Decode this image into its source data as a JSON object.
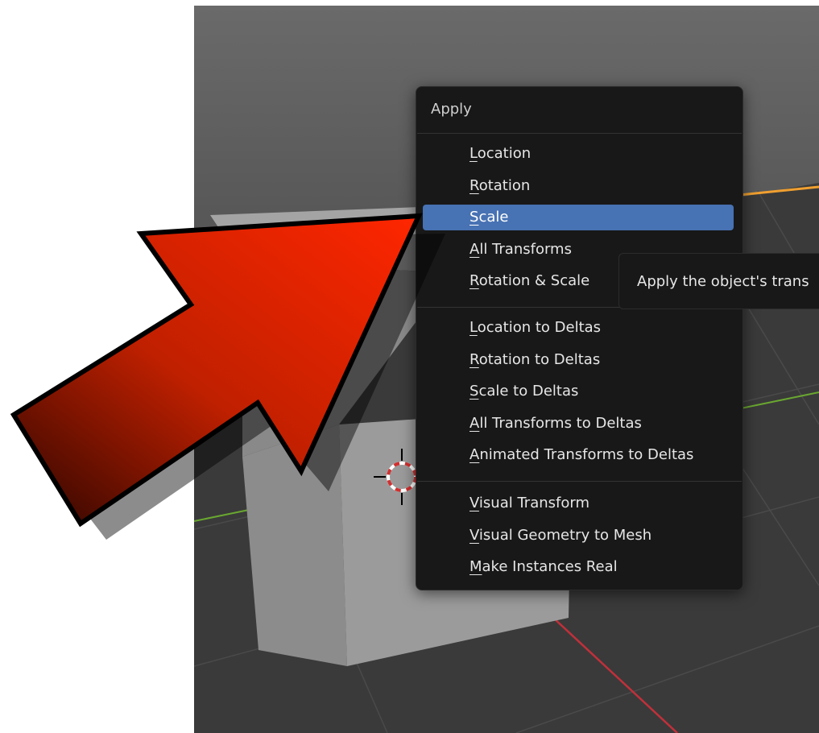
{
  "menu": {
    "title": "Apply",
    "groups": [
      [
        {
          "label": "Location",
          "ul": "L",
          "rest": "ocation",
          "active": false
        },
        {
          "label": "Rotation",
          "ul": "R",
          "rest": "otation",
          "active": false
        },
        {
          "label": "Scale",
          "ul": "S",
          "rest": "cale",
          "active": true
        },
        {
          "label": "All Transforms",
          "ul": "A",
          "rest": "ll Transforms",
          "active": false
        },
        {
          "label": "Rotation & Scale",
          "ul": "R",
          "rest": "otation & Scale",
          "active": false
        }
      ],
      [
        {
          "label": "Location to Deltas",
          "ul": "L",
          "rest": "ocation to Deltas",
          "active": false
        },
        {
          "label": "Rotation to Deltas",
          "ul": "R",
          "rest": "otation to Deltas",
          "active": false
        },
        {
          "label": "Scale to Deltas",
          "ul": "S",
          "rest": "cale to Deltas",
          "active": false
        },
        {
          "label": "All Transforms to Deltas",
          "ul": "A",
          "rest": "ll Transforms to Deltas",
          "active": false
        },
        {
          "label": "Animated Transforms to Deltas",
          "ul": "A",
          "rest": "nimated Transforms to Deltas",
          "active": false
        }
      ],
      [
        {
          "label": "Visual Transform",
          "ul": "V",
          "rest": "isual Transform",
          "active": false
        },
        {
          "label": "Visual Geometry to Mesh",
          "ul": "V",
          "rest": "isual Geometry to Mesh",
          "active": false
        },
        {
          "label": "Make Instances Real",
          "ul": "M",
          "rest": "ake Instances Real",
          "active": false
        }
      ]
    ]
  },
  "tooltip": {
    "text": "Apply the object's trans"
  },
  "colors": {
    "viewport_bg": "#3d3d3d",
    "menu_bg": "#181818",
    "highlight": "#4772b3",
    "arrow_fill": "#e83000",
    "x_axis": "#c0303a",
    "y_axis": "#6aa830",
    "selection_outline": "#f0a030"
  },
  "icons": {
    "cursor": "3d-cursor-icon",
    "arrow": "red-pointer-arrow-icon"
  }
}
